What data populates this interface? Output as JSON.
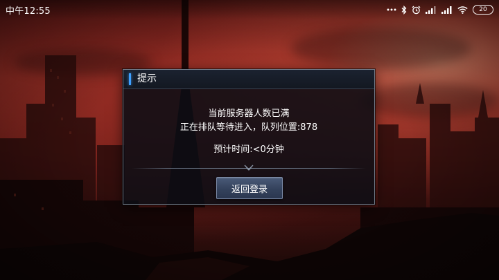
{
  "status_bar": {
    "time": "中午12:55",
    "battery": "20"
  },
  "dialog": {
    "title": "提示",
    "lines": [
      "当前服务器人数已满",
      "正在排队等待进入，队列位置:878"
    ],
    "eta": "预计时间:<0分钟",
    "button_label": "返回登录"
  },
  "colors": {
    "accent": "#3fa0ff",
    "button": "#3a4862",
    "sky": "#8a2a22"
  }
}
